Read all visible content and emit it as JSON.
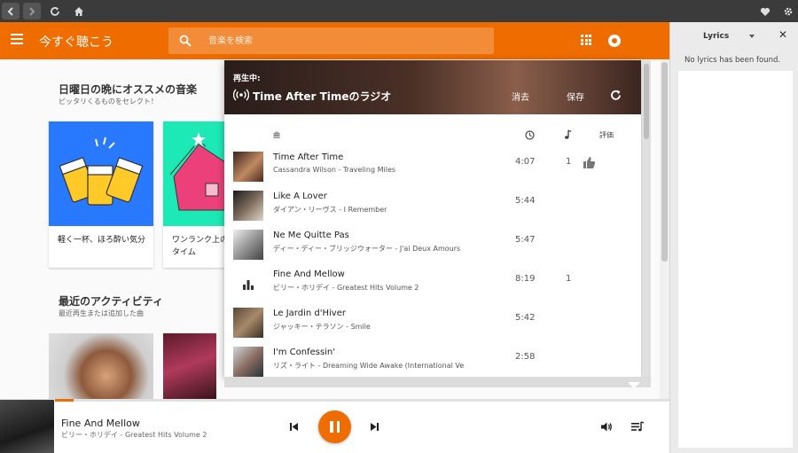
{
  "app": {
    "title": "今すぐ聴こう"
  },
  "search": {
    "placeholder": "音楽を検索"
  },
  "colors": {
    "accent": "#ef6c00",
    "topbar": "#3b3b3b"
  },
  "browser_toolbar": {
    "icons": [
      "back-icon",
      "forward-icon",
      "reload-icon",
      "home-icon",
      "heart-icon",
      "gear-icon"
    ]
  },
  "sections": {
    "recommend": {
      "heading": "日曜日の晩にオススメの音楽",
      "subheading": "ピッタリくるものをセレクト！",
      "cards": [
        {
          "label": "軽く一杯、ほろ酔い気分",
          "icon": "beer-cheers-icon",
          "bg": "#2979ff"
        },
        {
          "label": "ワンランク上のタイム",
          "icon": "house-icon",
          "bg": "#1de9b6"
        }
      ]
    },
    "recent": {
      "heading": "最近のアクティビティ",
      "subheading": "最近再生または追加した曲"
    }
  },
  "queue": {
    "now_playing_label": "再生中:",
    "station": "Time After Timeのラジオ",
    "clear_label": "消去",
    "save_label": "保存",
    "columns": {
      "title": "曲",
      "rating": "評価"
    },
    "tracks": [
      {
        "title": "Time After Time",
        "subtitle": "Cassandra Wilson - Traveling Miles",
        "duration": "4:07",
        "plays": "1",
        "thumbs_up": true,
        "playing": false
      },
      {
        "title": "Like A Lover",
        "subtitle": "ダイアン・リーヴス - I Remember",
        "duration": "5:44",
        "plays": "",
        "thumbs_up": false,
        "playing": false
      },
      {
        "title": "Ne Me Quitte Pas",
        "subtitle": "ディー・ディー・ブリッジウォーター - J'ai Deux Amours",
        "duration": "5:47",
        "plays": "",
        "thumbs_up": false,
        "playing": false
      },
      {
        "title": "Fine And Mellow",
        "subtitle": "ビリー・ホリデイ - Greatest Hits Volume 2",
        "duration": "8:19",
        "plays": "1",
        "thumbs_up": false,
        "playing": true
      },
      {
        "title": "Le Jardin d'Hiver",
        "subtitle": "ジャッキー・テラソン - Smile",
        "duration": "5:42",
        "plays": "",
        "thumbs_up": false,
        "playing": false
      },
      {
        "title": "I'm Confessin'",
        "subtitle": "リズ・ライト - Dreaming Wide Awake (International Version)",
        "duration": "2:58",
        "plays": "",
        "thumbs_up": false,
        "playing": false
      }
    ]
  },
  "player": {
    "title": "Fine And Mellow",
    "subtitle": "ビリー・ホリデイ - Greatest Hits Volume 2",
    "progress_fraction": 0.03
  },
  "lyrics": {
    "title": "Lyrics",
    "message": "No lyrics has been found."
  }
}
